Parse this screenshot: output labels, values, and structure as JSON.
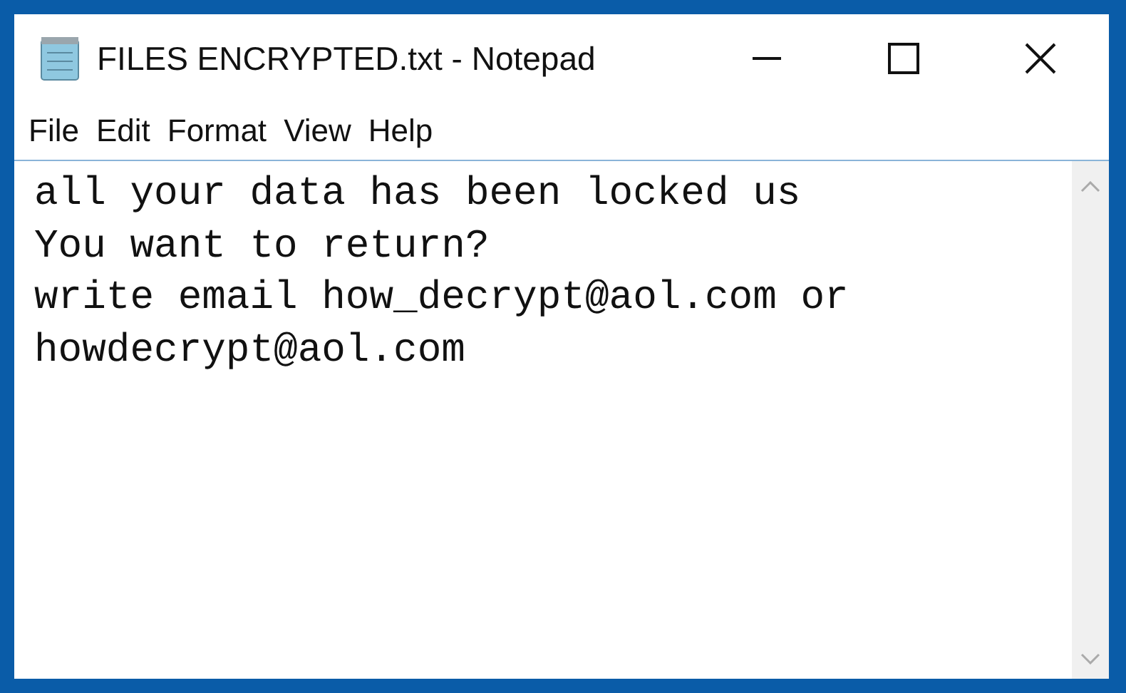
{
  "window": {
    "title": "FILES ENCRYPTED.txt - Notepad"
  },
  "menu": [
    "File",
    "Edit",
    "Format",
    "View",
    "Help"
  ],
  "document": {
    "lines": [
      "all your data has been locked us",
      "You want to return?",
      "write email how_decrypt@aol.com or",
      "howdecrypt@aol.com"
    ]
  }
}
